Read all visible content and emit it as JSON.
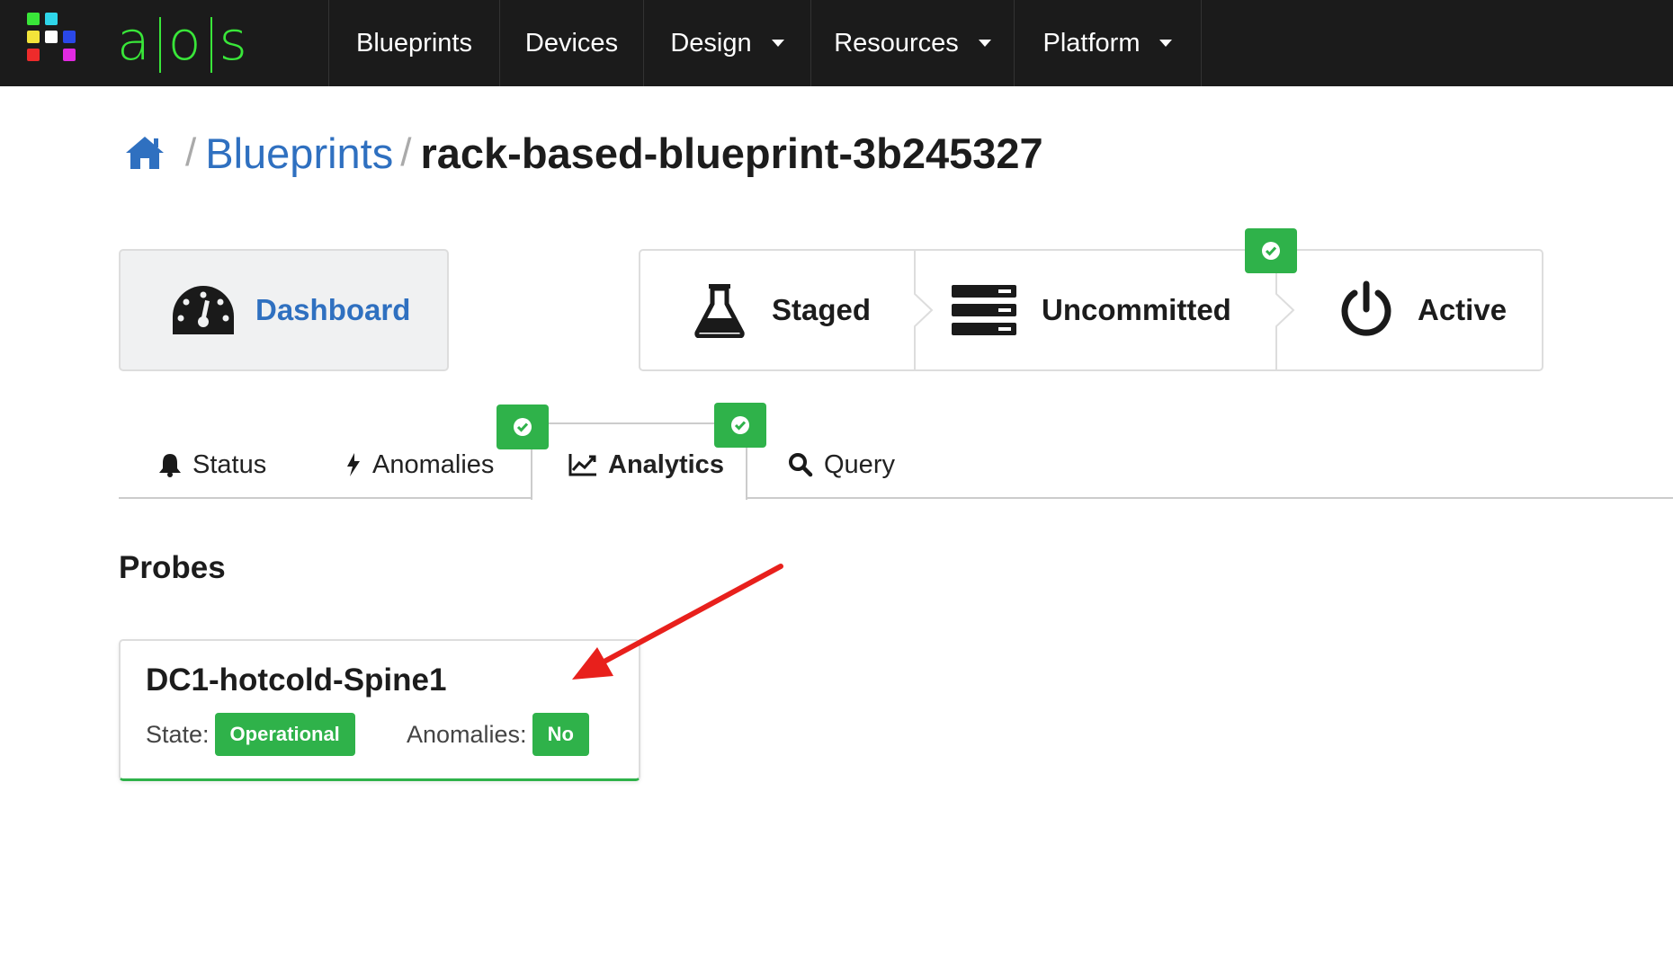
{
  "nav": {
    "logo_text": "aos",
    "items": [
      {
        "label": "Blueprints",
        "dropdown": false
      },
      {
        "label": "Devices",
        "dropdown": false
      },
      {
        "label": "Design",
        "dropdown": true
      },
      {
        "label": "Resources",
        "dropdown": true
      },
      {
        "label": "Platform",
        "dropdown": true
      }
    ]
  },
  "breadcrumb": {
    "home_icon": "home-icon",
    "separator": "/",
    "parent": "Blueprints",
    "current": "rack-based-blueprint-3b245327"
  },
  "dashboard": {
    "label": "Dashboard",
    "icon": "dashboard-gauge-icon"
  },
  "states": [
    {
      "label": "Staged",
      "icon": "flask-icon"
    },
    {
      "label": "Uncommitted",
      "icon": "server-stack-icon"
    },
    {
      "label": "Active",
      "icon": "power-icon"
    }
  ],
  "tabs": [
    {
      "label": "Status",
      "icon": "bell-icon"
    },
    {
      "label": "Anomalies",
      "icon": "bolt-icon"
    },
    {
      "label": "Analytics",
      "icon": "line-chart-icon",
      "active": true
    },
    {
      "label": "Query",
      "icon": "search-icon"
    }
  ],
  "probes": {
    "title": "Probes",
    "items": [
      {
        "name": "DC1-hotcold-Spine1",
        "state_label": "State:",
        "state": "Operational",
        "anomalies_label": "Anomalies:",
        "anomalies": "No"
      }
    ]
  },
  "colors": {
    "nav_bg": "#1b1b1b",
    "logo_green": "#39e639",
    "link_blue": "#2f70c0",
    "success_green": "#2fb24a",
    "annotation_red": "#e8201c"
  }
}
